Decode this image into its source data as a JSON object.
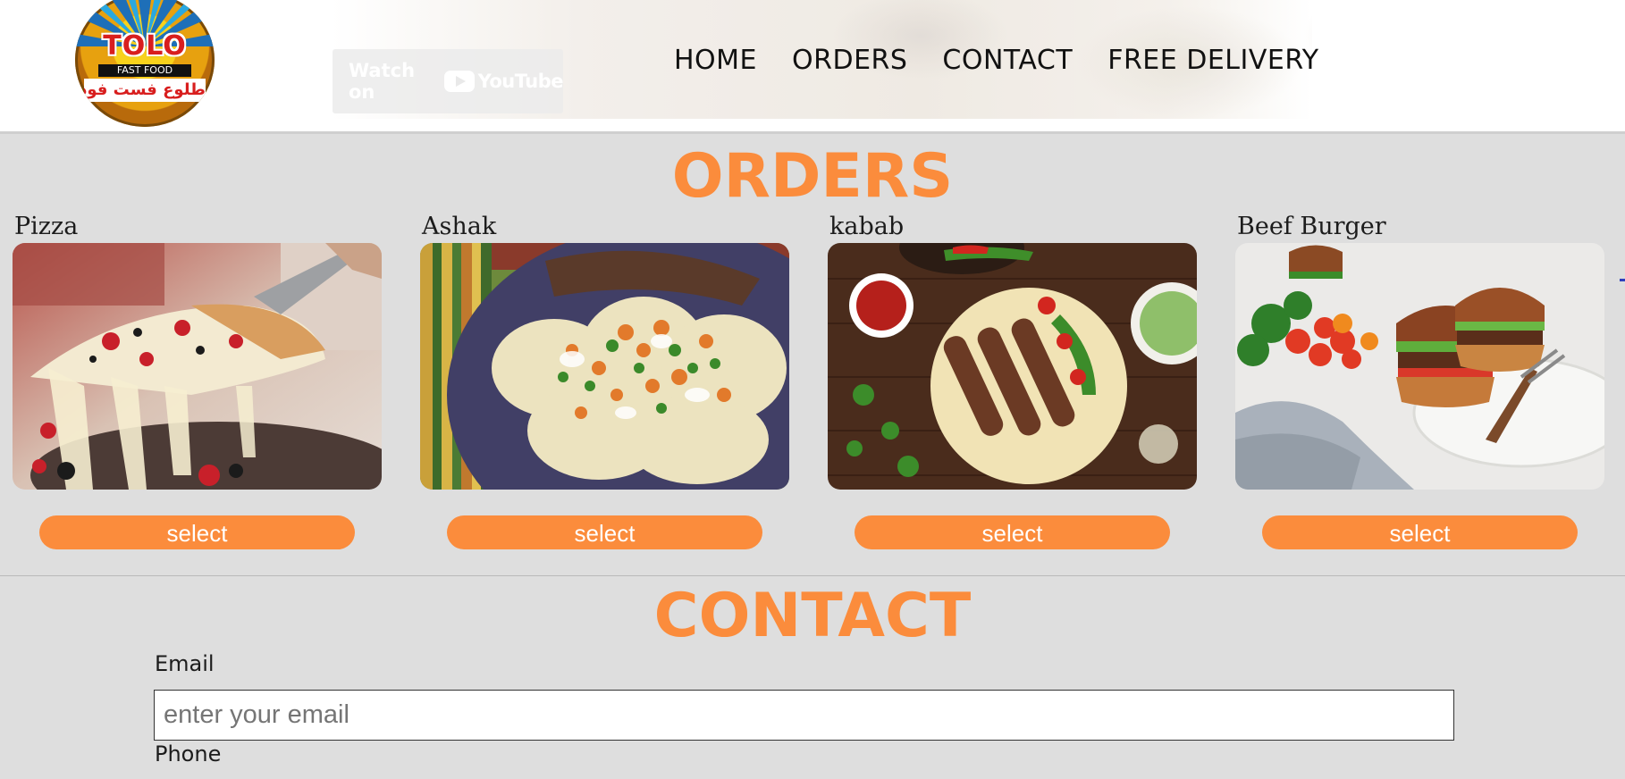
{
  "header": {
    "logo": {
      "title": "TOLO",
      "subtitle": "FAST FOOD",
      "arabic": "طلوع فست فود"
    },
    "video_overlay": {
      "watch_label": "Watch on",
      "platform_label": "YouTube",
      "icon": "youtube-play-icon"
    },
    "nav": [
      {
        "label": "HOME"
      },
      {
        "label": "ORDERS"
      },
      {
        "label": "CONTACT"
      },
      {
        "label": "FREE DELIVERY"
      }
    ]
  },
  "orders": {
    "title": "ORDERS",
    "items": [
      {
        "name": "Pizza",
        "button": "select"
      },
      {
        "name": "Ashak",
        "button": "select"
      },
      {
        "name": "kabab",
        "button": "select"
      },
      {
        "name": "Beef Burger",
        "button": "select"
      }
    ]
  },
  "contact": {
    "title": "CONTACT",
    "email_label": "Email",
    "email_placeholder": "enter your email",
    "email_value": "",
    "phone_label": "Phone"
  },
  "colors": {
    "accent": "#fb8c3c",
    "page_bg": "#dedede",
    "header_bg": "#ffffff"
  }
}
